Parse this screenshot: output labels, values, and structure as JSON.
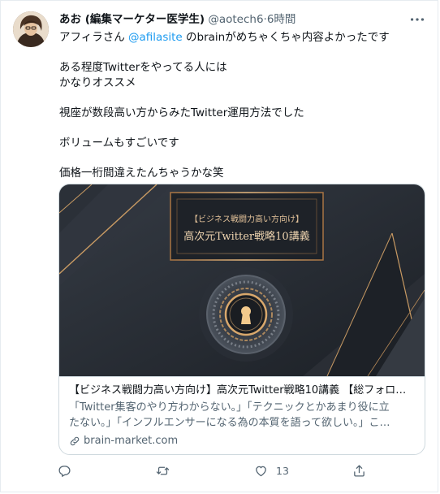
{
  "tweet": {
    "author": {
      "display_name": "あお (編集マーケター医学生)",
      "handle": "@aotech6",
      "separator": "·",
      "time": "6時間"
    },
    "body": {
      "line1_prefix": "アフィラさん ",
      "mention": "@afilasite",
      "line1_suffix": " のbrainがめちゃくちゃ内容よかったです",
      "line2": "ある程度Twitterをやってる人には",
      "line3": "かなりオススメ",
      "line4": "視座が数段高い方からみたTwitter運用方法でした",
      "line5": "ボリュームもすごいです",
      "line6": "価格一桁間違えたんちゃうかな笑"
    },
    "card": {
      "image": {
        "banner_subtitle": "【ビジネス戦闘力高い方向け】",
        "banner_title": "高次元Twitter戦略10講義"
      },
      "title": "【ビジネス戦闘力高い方向け】高次元Twitter戦略10講義 【総フォロ…",
      "description_line1": "「Twitter集客のやり方わからない。」「テクニックとかあまり役に立",
      "description_line2": "たない。」「インフルエンサーになる為の本質を語って欲しい。」こ…",
      "domain": "brain-market.com"
    },
    "actions": {
      "reply_count": "",
      "retweet_count": "",
      "like_count": "13",
      "share_label": ""
    },
    "icons": [
      "more-icon",
      "link-icon",
      "reply-icon",
      "retweet-icon",
      "like-icon",
      "share-icon",
      "keyhole-icon"
    ],
    "colors": {
      "accent": "#1d9bf0",
      "secondary_text": "#536471",
      "border": "#cfd9de",
      "card_bg": "#23272e",
      "gold": "#c89a63"
    }
  }
}
